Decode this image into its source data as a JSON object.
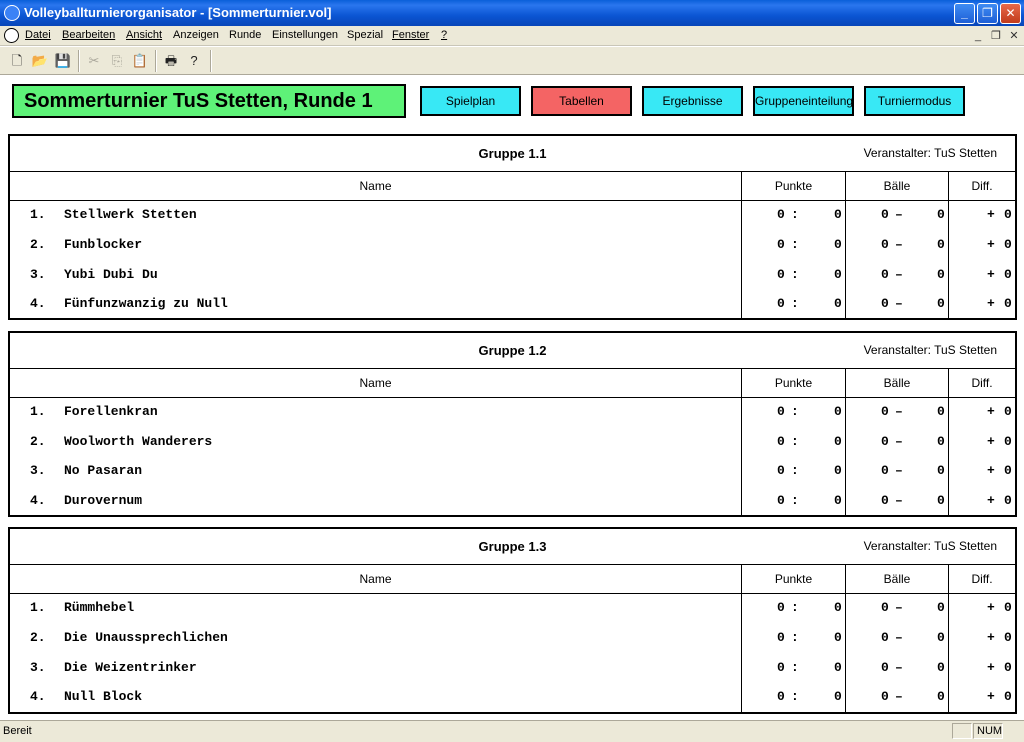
{
  "window": {
    "title": "Volleyballturnierorganisator - [Sommerturnier.vol]"
  },
  "menu": {
    "items": [
      {
        "label": "Datei"
      },
      {
        "label": "Bearbeiten"
      },
      {
        "label": "Ansicht"
      },
      {
        "label": "Anzeigen"
      },
      {
        "label": "Runde"
      },
      {
        "label": "Einstellungen"
      },
      {
        "label": "Spezial"
      },
      {
        "label": "Fenster"
      },
      {
        "label": "?"
      }
    ]
  },
  "toolbar": {
    "buttons": [
      "new-file-icon",
      "open-folder-icon",
      "save-icon",
      "cut-icon",
      "copy-icon",
      "paste-icon",
      "print-icon",
      "help-icon"
    ]
  },
  "header": {
    "tournament_title": "Sommerturnier TuS Stetten, Runde 1",
    "buttons": [
      {
        "label": "Spielplan",
        "color": "#38e8f5"
      },
      {
        "label": "Tabellen",
        "color": "#f46464"
      },
      {
        "label": "Ergebnisse",
        "color": "#38e8f5"
      },
      {
        "label": "Gruppeneinteilung",
        "color": "#38e8f5"
      },
      {
        "label": "Turniermodus",
        "color": "#38e8f5"
      }
    ]
  },
  "columns": {
    "name": "Name",
    "points": "Punkte",
    "balls": "Bälle",
    "diff": "Diff."
  },
  "groups": [
    {
      "title": "Gruppe 1.1",
      "organizer": "Veranstalter: TuS Stetten",
      "rows": [
        {
          "rank": "1.",
          "team": "Stellwerk Stetten",
          "p1": "0",
          "p_sep": ":",
          "p2": "0",
          "b1": "0",
          "b_sep": "–",
          "b2": "0",
          "diff_sign": "+",
          "diff": "0"
        },
        {
          "rank": "2.",
          "team": "Funblocker",
          "p1": "0",
          "p_sep": ":",
          "p2": "0",
          "b1": "0",
          "b_sep": "–",
          "b2": "0",
          "diff_sign": "+",
          "diff": "0"
        },
        {
          "rank": "3.",
          "team": "Yubi Dubi Du",
          "p1": "0",
          "p_sep": ":",
          "p2": "0",
          "b1": "0",
          "b_sep": "–",
          "b2": "0",
          "diff_sign": "+",
          "diff": "0"
        },
        {
          "rank": "4.",
          "team": "Fünfunzwanzig zu Null",
          "p1": "0",
          "p_sep": ":",
          "p2": "0",
          "b1": "0",
          "b_sep": "–",
          "b2": "0",
          "diff_sign": "+",
          "diff": "0"
        }
      ]
    },
    {
      "title": "Gruppe 1.2",
      "organizer": "Veranstalter: TuS Stetten",
      "rows": [
        {
          "rank": "1.",
          "team": "Forellenkran",
          "p1": "0",
          "p_sep": ":",
          "p2": "0",
          "b1": "0",
          "b_sep": "–",
          "b2": "0",
          "diff_sign": "+",
          "diff": "0"
        },
        {
          "rank": "2.",
          "team": "Woolworth Wanderers",
          "p1": "0",
          "p_sep": ":",
          "p2": "0",
          "b1": "0",
          "b_sep": "–",
          "b2": "0",
          "diff_sign": "+",
          "diff": "0"
        },
        {
          "rank": "3.",
          "team": "No Pasaran",
          "p1": "0",
          "p_sep": ":",
          "p2": "0",
          "b1": "0",
          "b_sep": "–",
          "b2": "0",
          "diff_sign": "+",
          "diff": "0"
        },
        {
          "rank": "4.",
          "team": "Durovernum",
          "p1": "0",
          "p_sep": ":",
          "p2": "0",
          "b1": "0",
          "b_sep": "–",
          "b2": "0",
          "diff_sign": "+",
          "diff": "0"
        }
      ]
    },
    {
      "title": "Gruppe 1.3",
      "organizer": "Veranstalter: TuS Stetten",
      "rows": [
        {
          "rank": "1.",
          "team": "Rümmhebel",
          "p1": "0",
          "p_sep": ":",
          "p2": "0",
          "b1": "0",
          "b_sep": "–",
          "b2": "0",
          "diff_sign": "+",
          "diff": "0"
        },
        {
          "rank": "2.",
          "team": "Die Unaussprechlichen",
          "p1": "0",
          "p_sep": ":",
          "p2": "0",
          "b1": "0",
          "b_sep": "–",
          "b2": "0",
          "diff_sign": "+",
          "diff": "0"
        },
        {
          "rank": "3.",
          "team": "Die Weizentrinker",
          "p1": "0",
          "p_sep": ":",
          "p2": "0",
          "b1": "0",
          "b_sep": "–",
          "b2": "0",
          "diff_sign": "+",
          "diff": "0"
        },
        {
          "rank": "4.",
          "team": "Null Block",
          "p1": "0",
          "p_sep": ":",
          "p2": "0",
          "b1": "0",
          "b_sep": "–",
          "b2": "0",
          "diff_sign": "+",
          "diff": "0"
        }
      ]
    }
  ],
  "statusbar": {
    "text": "Bereit",
    "num": "NUM"
  }
}
